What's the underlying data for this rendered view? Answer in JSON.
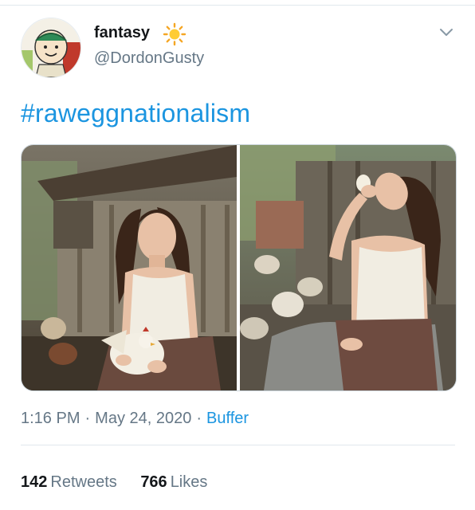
{
  "user": {
    "display_name": "fantasy",
    "handle": "@DordonGusty",
    "avatar_icon": "cartoon-avatar",
    "name_emoji_icon": "sun-icon"
  },
  "tweet": {
    "text": "#raweggnationalism",
    "time": "1:16 PM",
    "date": "May 24, 2020",
    "source": "Buffer"
  },
  "media": {
    "photos": [
      "photo-woman-holding-chicken",
      "photo-woman-drinking-raw-egg"
    ]
  },
  "stats": {
    "retweets_count": "142",
    "retweets_label": "Retweets",
    "likes_count": "766",
    "likes_label": "Likes"
  },
  "colors": {
    "accent": "#1b95e0",
    "secondary_text": "#657786",
    "divider": "#e1e8ed"
  }
}
